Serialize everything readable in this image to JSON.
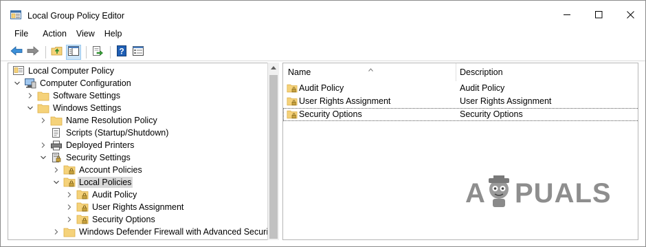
{
  "window": {
    "title": "Local Group Policy Editor",
    "minimize_icon": "minimize-icon",
    "maximize_icon": "maximize-icon",
    "close_icon": "close-icon"
  },
  "menu": {
    "items": [
      "File",
      "Action",
      "View",
      "Help"
    ]
  },
  "toolbar": {
    "buttons": [
      "back-icon",
      "forward-icon",
      "up-folder-icon",
      "show-hide-console-tree-icon",
      "export-list-icon",
      "help-icon",
      "properties-view-icon"
    ]
  },
  "tree": {
    "items": [
      {
        "label": "Local Computer Policy",
        "icon": "computer-policy-icon",
        "level": 0,
        "expander": "none"
      },
      {
        "label": "Computer Configuration",
        "icon": "computer-icon",
        "level": 1,
        "expander": "expanded"
      },
      {
        "label": "Software Settings",
        "icon": "folder-icon",
        "level": 2,
        "expander": "collapsed"
      },
      {
        "label": "Windows Settings",
        "icon": "folder-icon",
        "level": 2,
        "expander": "expanded"
      },
      {
        "label": "Name Resolution Policy",
        "icon": "folder-icon",
        "level": 3,
        "expander": "collapsed"
      },
      {
        "label": "Scripts (Startup/Shutdown)",
        "icon": "scripts-icon",
        "level": 3,
        "expander": "none"
      },
      {
        "label": "Deployed Printers",
        "icon": "printer-icon",
        "level": 3,
        "expander": "collapsed"
      },
      {
        "label": "Security Settings",
        "icon": "security-settings-icon",
        "level": 3,
        "expander": "expanded"
      },
      {
        "label": "Account Policies",
        "icon": "locked-folder-icon",
        "level": 4,
        "expander": "collapsed"
      },
      {
        "label": "Local Policies",
        "icon": "locked-folder-icon",
        "level": 4,
        "expander": "expanded",
        "selected": true
      },
      {
        "label": "Audit Policy",
        "icon": "locked-folder-icon",
        "level": 5,
        "expander": "collapsed"
      },
      {
        "label": "User Rights Assignment",
        "icon": "locked-folder-icon",
        "level": 5,
        "expander": "collapsed"
      },
      {
        "label": "Security Options",
        "icon": "locked-folder-icon",
        "level": 5,
        "expander": "collapsed"
      },
      {
        "label": "Windows Defender Firewall with Advanced Security",
        "icon": "folder-icon",
        "level": 4,
        "expander": "collapsed"
      }
    ]
  },
  "list": {
    "columns": [
      "Name",
      "Description"
    ],
    "rows": [
      {
        "name": "Audit Policy",
        "description": "Audit Policy"
      },
      {
        "name": "User Rights Assignment",
        "description": "User Rights Assignment"
      },
      {
        "name": "Security Options",
        "description": "Security Options"
      }
    ]
  },
  "watermark": {
    "text_left": "A",
    "text_right": "PUALS",
    "color": "#8e8e8e"
  },
  "colors": {
    "folder": "#f5d27a",
    "folder_dark": "#dcae45",
    "lock": "#c8a13c",
    "selection": "#d9d9d9",
    "toolbar_active": "#cce4f7"
  }
}
